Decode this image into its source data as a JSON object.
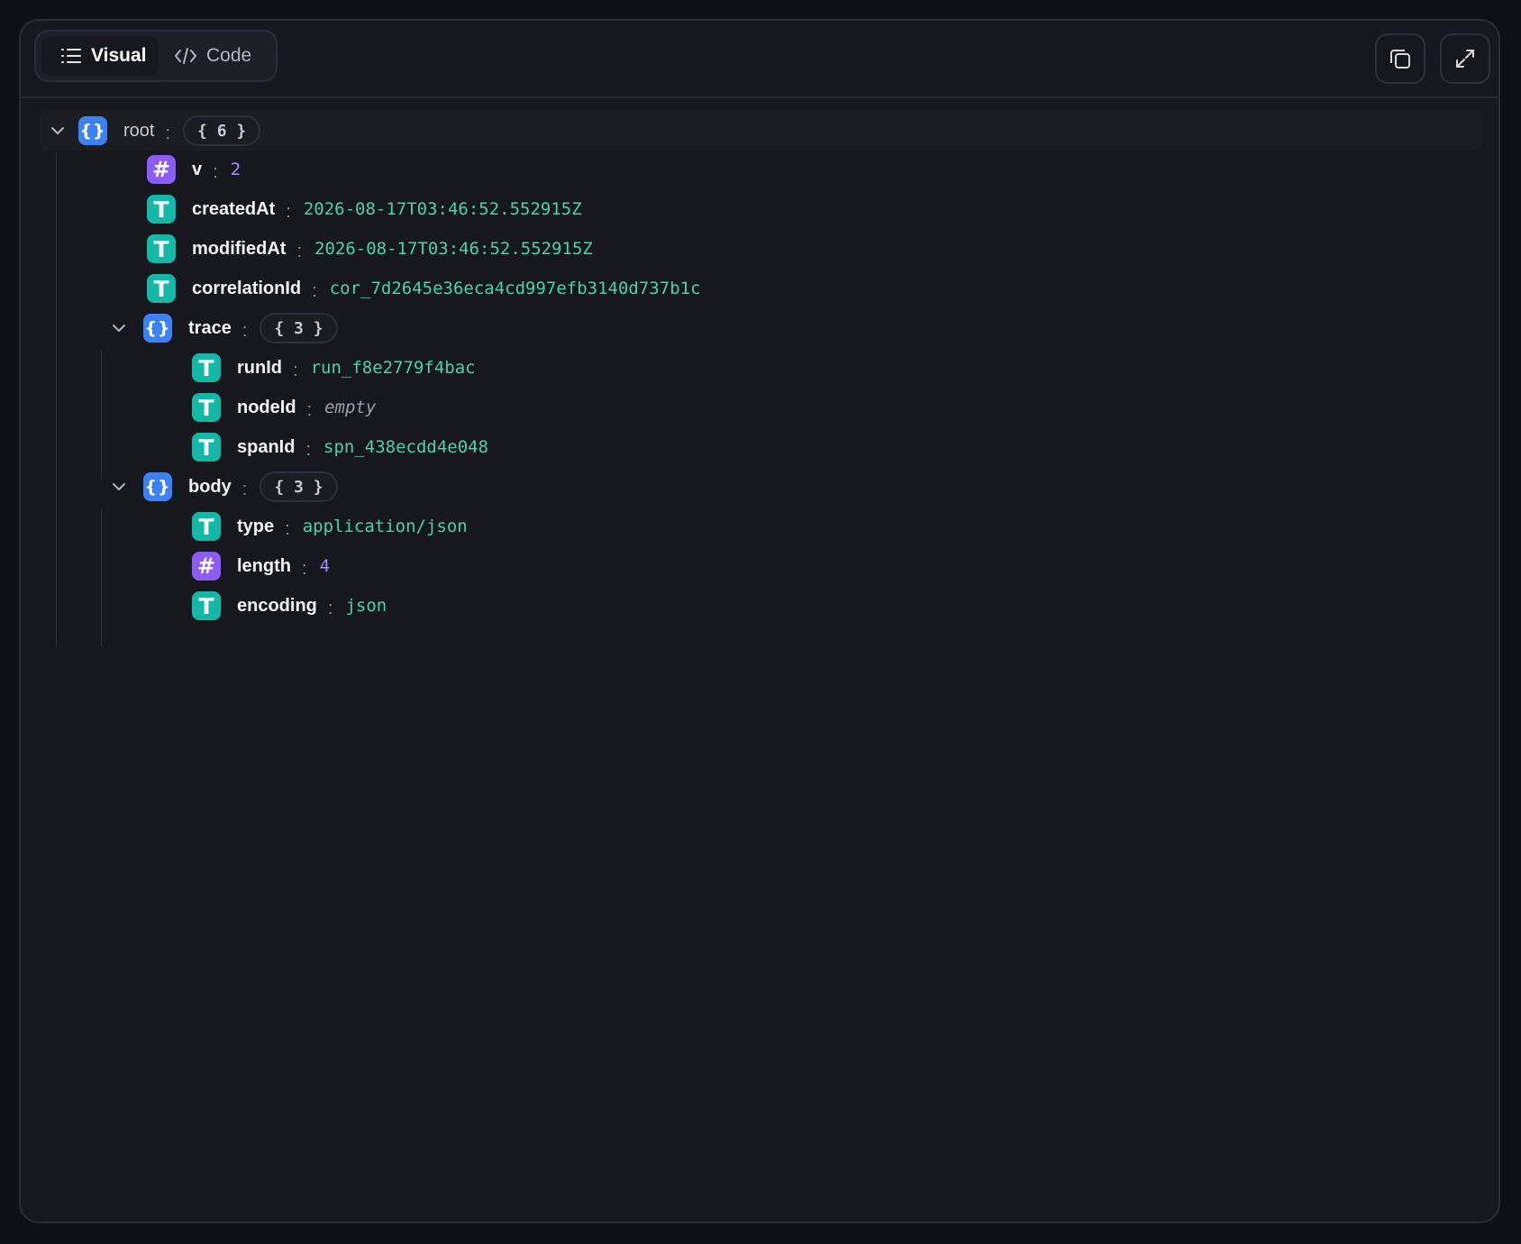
{
  "toolbar": {
    "tabs": [
      {
        "label": "Visual",
        "active": true
      },
      {
        "label": "Code",
        "active": false
      }
    ],
    "copy_icon": "copy-icon",
    "expand_icon": "expand-icon"
  },
  "tree": {
    "root": {
      "key": "root",
      "count": "{ 6 }"
    },
    "v": {
      "key": "v",
      "value": "2"
    },
    "createdAt": {
      "key": "createdAt",
      "value": "2026-08-17T03:46:52.552915Z"
    },
    "modifiedAt": {
      "key": "modifiedAt",
      "value": "2026-08-17T03:46:52.552915Z"
    },
    "correlationId": {
      "key": "correlationId",
      "value": "cor_7d2645e36eca4cd997efb3140d737b1c"
    },
    "trace": {
      "key": "trace",
      "count": "{ 3 }",
      "runId": {
        "key": "runId",
        "value": "run_f8e2779f4bac"
      },
      "nodeId": {
        "key": "nodeId",
        "value": "empty"
      },
      "spanId": {
        "key": "spanId",
        "value": "spn_438ecdd4e048"
      }
    },
    "body": {
      "key": "body",
      "count": "{ 3 }",
      "type": {
        "key": "type",
        "value": "application/json"
      },
      "length": {
        "key": "length",
        "value": "4"
      },
      "encoding": {
        "key": "encoding",
        "value": "json"
      }
    }
  },
  "badges": {
    "object": "{}",
    "number": "#",
    "string": "T"
  },
  "colors": {
    "object_badge": "#3b82f6",
    "number_badge": "#8b5cf6",
    "string_badge": "#14b8a6",
    "string_value": "#4fd1a5",
    "number_value": "#a78bfa"
  }
}
